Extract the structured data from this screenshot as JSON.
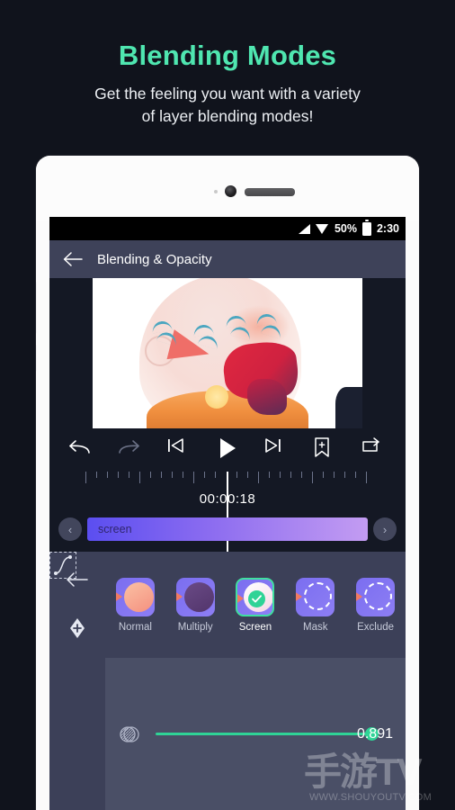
{
  "promo": {
    "title": "Blending Modes",
    "subtitle_line1": "Get the feeling you want with a variety",
    "subtitle_line2": "of layer blending modes!",
    "title_color": "#4fe6b0"
  },
  "statusbar": {
    "battery_percent": "50%",
    "time": "2:30",
    "signal_icon": "signal-icon",
    "wifi_icon": "wifi-icon",
    "battery_icon": "battery-icon"
  },
  "appbar": {
    "title": "Blending & Opacity",
    "back_icon": "back-arrow-icon"
  },
  "transport": {
    "undo": "undo-icon",
    "redo": "redo-icon",
    "skip_start": "skip-to-start-icon",
    "play": "play-icon",
    "skip_end": "skip-to-end-icon",
    "bookmark": "bookmark-add-icon",
    "loop": "loop-icon"
  },
  "timeline": {
    "timecode": "00:00:18",
    "clip_label": "screen",
    "prev_label": "‹",
    "next_label": "›"
  },
  "rail": {
    "back_icon": "back-arrow-icon",
    "keyframe_icon": "keyframe-add-icon",
    "easing_icon": "easing-curve-icon"
  },
  "blend_modes": {
    "selected": "Screen",
    "items": [
      {
        "label": "Normal",
        "selected": false
      },
      {
        "label": "Multiply",
        "selected": false
      },
      {
        "label": "Screen",
        "selected": true
      },
      {
        "label": "Mask",
        "selected": false
      },
      {
        "label": "Exclude",
        "selected": false
      }
    ]
  },
  "opacity": {
    "value": "0.891",
    "icon": "opacity-icon",
    "accent_color": "#2fd396"
  },
  "watermark": {
    "logo_text": "手游TV",
    "url": "WWW.SHOUYOUTV.COM"
  }
}
